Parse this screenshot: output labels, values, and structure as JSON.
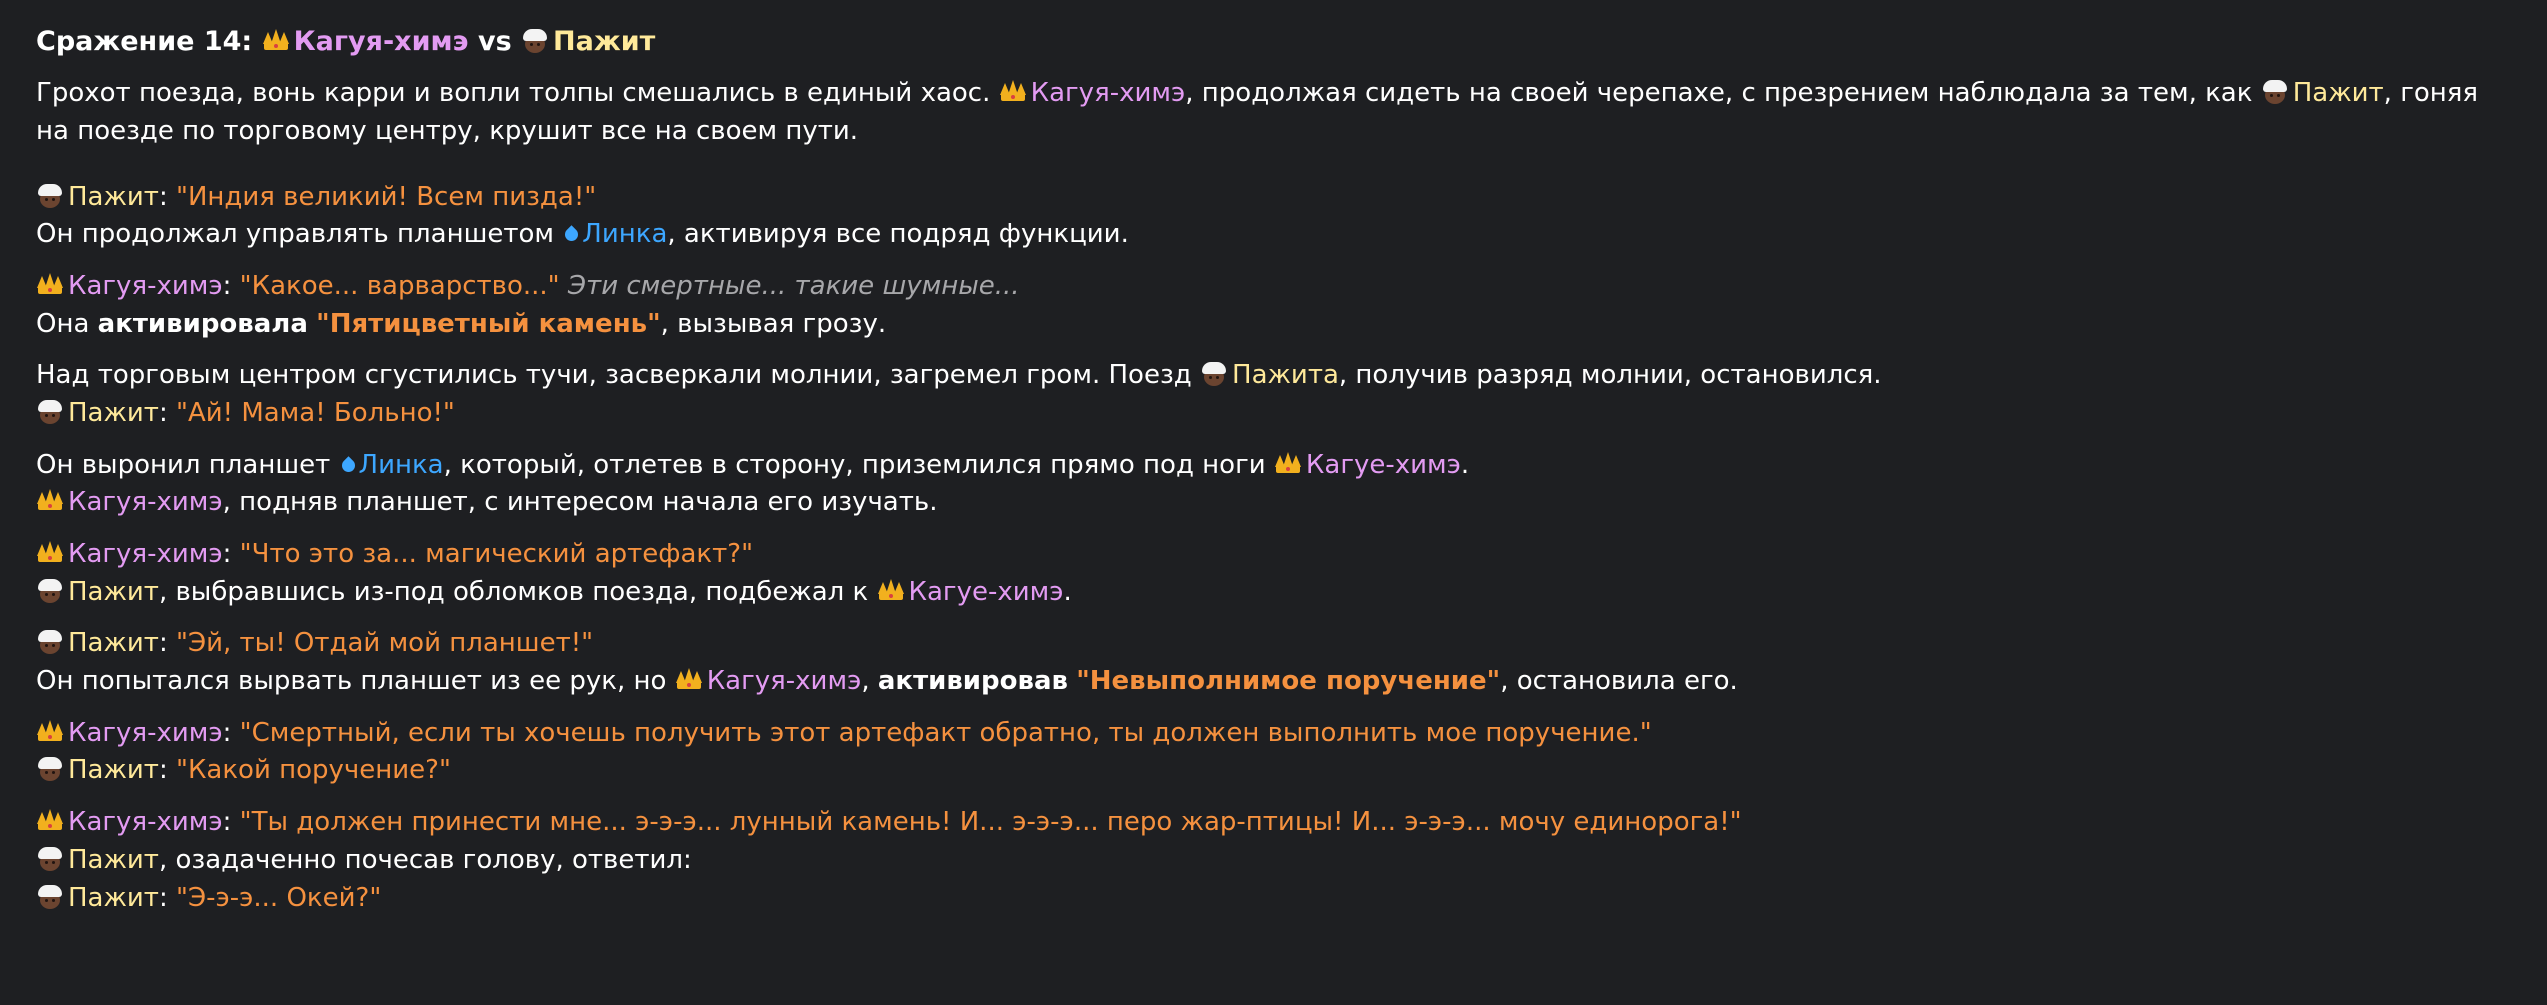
{
  "heading": {
    "prefix": "Сражение 14:",
    "vs": "vs"
  },
  "names": {
    "kaguya": "Кагуя-химэ",
    "kaguya_dat": "Кагуе-химэ",
    "pajit": "Пажит",
    "pajita": "Пажита",
    "linka": "Линка"
  },
  "icons": {
    "kaguya": "crown-icon",
    "pajit": "turbaned-man-icon",
    "linka": "droplet-icon"
  },
  "colors": {
    "background": "#1e1f22",
    "kaguya": "#e39bf2",
    "pajit": "#ffe99a",
    "linka": "#3da7ff",
    "quote": "#f5913f",
    "italic": "#a7a7aa"
  },
  "p1": {
    "a": "Грохот поезда, вонь карри и вопли толпы смешались в единый хаос.",
    "b": ", продолжая сидеть на своей черепахе, с презрением наблюдала за тем, как",
    "c": ", гоняя на поезде по торговому центру, крушит все на своем пути."
  },
  "l2": {
    "colon": ":",
    "quote": "\"Индия великий! Всем пизда!\""
  },
  "l3": {
    "a": "Он продолжал управлять планшетом",
    "b": ", активируя все подряд функции."
  },
  "l4": {
    "colon": ":",
    "quote": "\"Какое... варварство...\"",
    "thought": "Эти смертные... такие шумные..."
  },
  "l5": {
    "a": "Она",
    "bold": "активировала",
    "quote": "\"Пятицветный камень\"",
    "b": ", вызывая грозу."
  },
  "l6": {
    "a": "Над торговым центром сгустились тучи, засверкали молнии, загремел гром. Поезд",
    "b": ", получив разряд молнии, остановился."
  },
  "l7": {
    "colon": ":",
    "quote": "\"Ай! Мама! Больно!\""
  },
  "l8": {
    "a": "Он выронил планшет",
    "b": ", который, отлетев в сторону, приземлился прямо под ноги",
    "c": "."
  },
  "l9": {
    "a": ", подняв планшет, с интересом начала его изучать."
  },
  "l10": {
    "colon": ":",
    "quote": "\"Что это за... магический артефакт?\""
  },
  "l11": {
    "a": ", выбравшись из-под обломков поезда, подбежал к",
    "b": "."
  },
  "l12": {
    "colon": ":",
    "quote": "\"Эй, ты! Отдай мой планшет!\""
  },
  "l13": {
    "a": "Он попытался вырвать планшет из ее рук, но",
    "bold": "активировав",
    "quote": "\"Невыполнимое поручение\"",
    "b": ", остановила его.",
    "comma": ","
  },
  "l14": {
    "colon": ":",
    "quote": "\"Смертный, если ты хочешь получить этот артефакт обратно, ты должен выполнить мое поручение.\""
  },
  "l15": {
    "colon": ":",
    "quote": "\"Какой поручение?\""
  },
  "l16": {
    "colon": ":",
    "quote": "\"Ты должен принести мне... э-э-э... лунный камень! И... э-э-э... перо жар-птицы! И... э-э-э... мочу единорога!\""
  },
  "l17": {
    "a": ", озадаченно почесав голову, ответил:"
  },
  "l18": {
    "colon": ":",
    "quote": "\"Э-э-э... Окей?\""
  }
}
